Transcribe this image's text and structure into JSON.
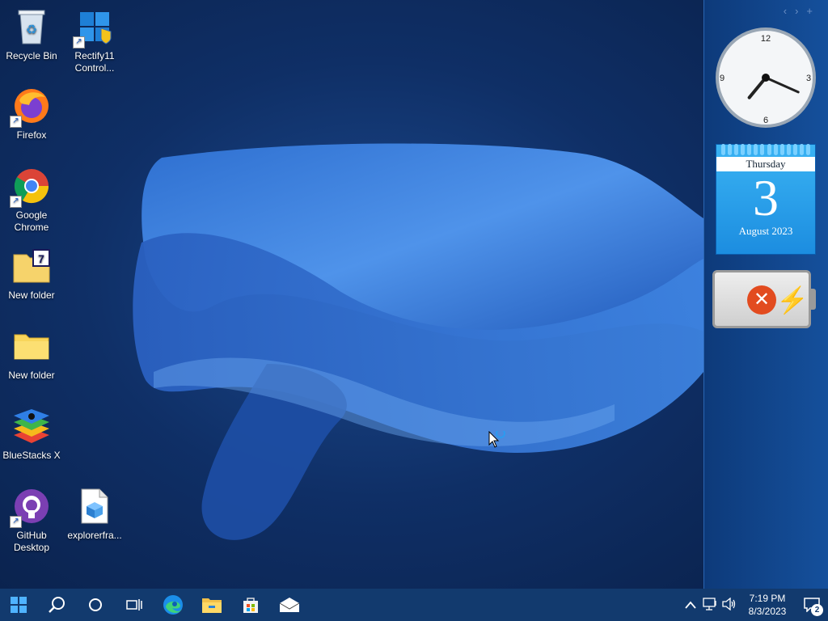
{
  "desktop": {
    "icons": [
      {
        "label": "Recycle Bin",
        "icon": "recycle-bin-icon"
      },
      {
        "label": "Rectify11 Control...",
        "icon": "control-panel-icon"
      },
      {
        "label": "Firefox",
        "icon": "firefox-icon"
      },
      {
        "label": "Google Chrome",
        "icon": "chrome-icon"
      },
      {
        "label": "New folder",
        "icon": "folder-7zip-icon"
      },
      {
        "label": "New folder",
        "icon": "folder-icon"
      },
      {
        "label": "BlueStacks X",
        "icon": "bluestacks-icon"
      },
      {
        "label": "GitHub Desktop",
        "icon": "github-desktop-icon"
      },
      {
        "label": "explorerfra...",
        "icon": "file-icon"
      }
    ]
  },
  "sidebar": {
    "nav": {
      "prev": "‹",
      "next": "›",
      "more": "+"
    },
    "clock": {
      "hours": 7,
      "minutes": 19,
      "numerals": [
        "12",
        "3",
        "6",
        "9"
      ]
    },
    "calendar": {
      "day_name": "Thursday",
      "day_number": "3",
      "month_year": "August 2023"
    },
    "battery": {
      "status_icon": "close-icon",
      "charging_icon": "bolt-icon"
    }
  },
  "taskbar": {
    "buttons": [
      "start-icon",
      "search-icon",
      "cortana-icon",
      "task-view-icon",
      "edge-icon",
      "file-explorer-icon",
      "store-icon",
      "mail-icon"
    ],
    "tray": {
      "time": "7:19 PM",
      "date": "8/3/2023",
      "notification_count": "2"
    }
  },
  "colors": {
    "taskbar": "#123a6e",
    "accent": "#3ab3f3"
  }
}
